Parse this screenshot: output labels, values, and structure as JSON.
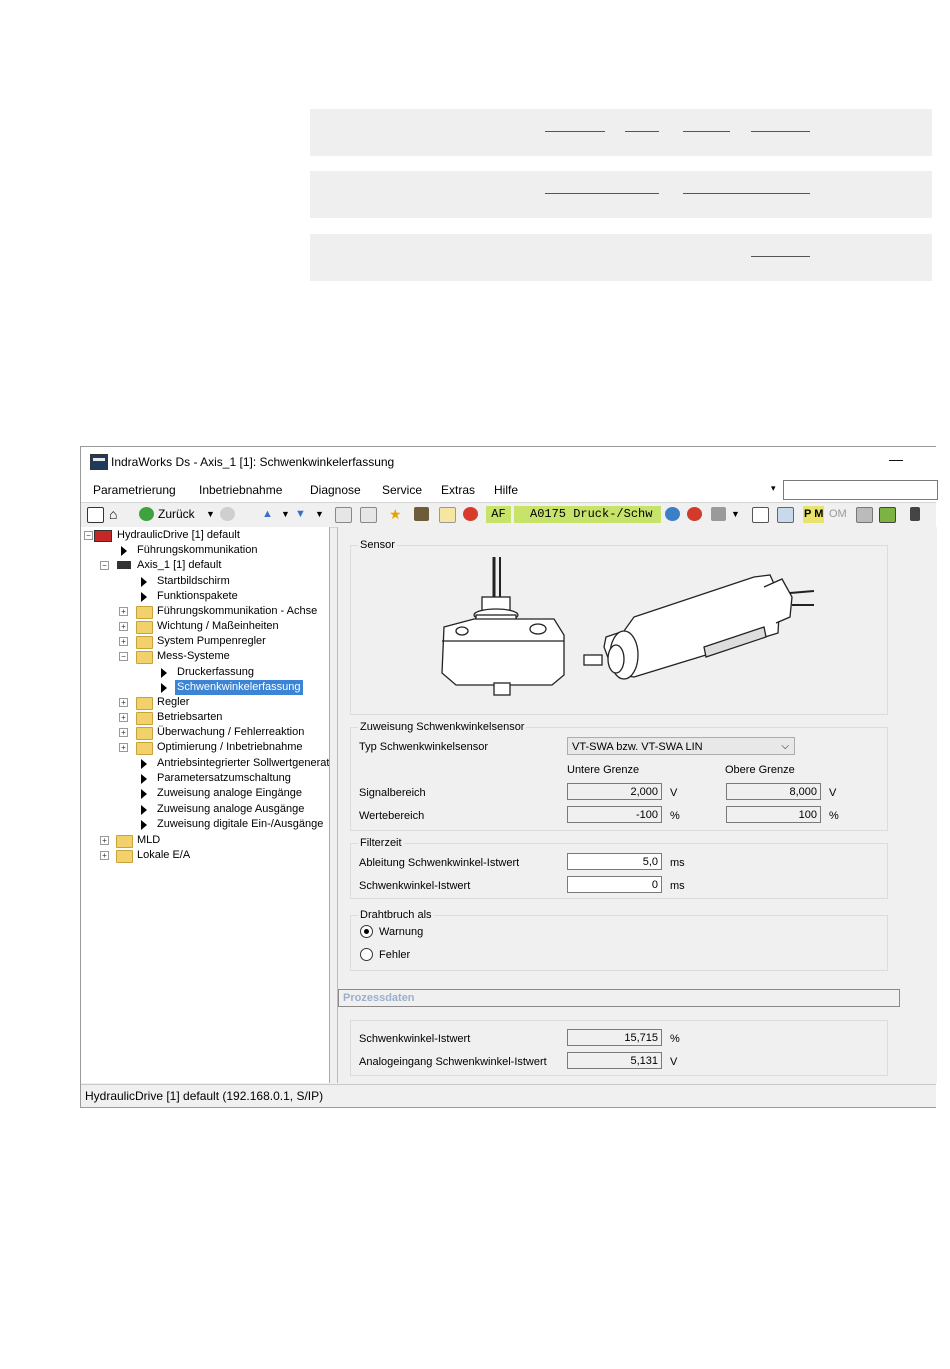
{
  "window": {
    "title": "IndraWorks Ds - Axis_1 [1]: Schwenkwinkelerfassung",
    "minimize_glyph": "—"
  },
  "menu": [
    "Parametrierung",
    "Inbetriebnahme",
    "Diagnose",
    "Service",
    "Extras",
    "Hilfe"
  ],
  "toolbar": {
    "back_label": "Zurück",
    "af_label": "AF",
    "status_code": "A0175 Druck-/Schw",
    "pm_label": "P M",
    "om_label": "OM"
  },
  "tree": {
    "root": "HydraulicDrive [1] default",
    "fuehrung": "Führungskommunikation",
    "axis": "Axis_1 [1] default",
    "items": [
      "Startbildschirm",
      "Funktionspakete",
      "Führungskommunikation - Achse",
      "Wichtung / Maßeinheiten",
      "System Pumpenregler",
      "Mess-Systeme",
      "Druckerfassung",
      "Schwenkwinkelerfassung",
      "Regler",
      "Betriebsarten",
      "Überwachung / Fehlerreaktion",
      "Optimierung / Inbetriebnahme",
      "Antriebsintegrierter Sollwertgenerat",
      "Parametersatzumschaltung",
      "Zuweisung analoge Eingänge",
      "Zuweisung analoge Ausgänge",
      "Zuweisung digitale Ein-/Ausgänge"
    ],
    "mld": "MLD",
    "lokale": "Lokale E/A"
  },
  "content": {
    "sensor_title": "Sensor",
    "assign": {
      "title": "Zuweisung Schwenkwinkelsensor",
      "type_label": "Typ Schwenkwinkelsensor",
      "type_value": "VT-SWA bzw. VT-SWA LIN",
      "lower_header": "Untere Grenze",
      "upper_header": "Obere Grenze",
      "signal_label": "Signalbereich",
      "signal_lower": "2,000",
      "signal_upper": "8,000",
      "signal_unit": "V",
      "werte_label": "Wertebereich",
      "werte_lower": "-100",
      "werte_upper": "100",
      "werte_unit": "%"
    },
    "filter": {
      "title": "Filterzeit",
      "ableitung_label": "Ableitung Schwenkwinkel-Istwert",
      "ableitung_value": "5,0",
      "ist_label": "Schwenkwinkel-Istwert",
      "ist_value": "0",
      "unit": "ms"
    },
    "draht": {
      "title": "Drahtbruch als",
      "opt1": "Warnung",
      "opt2": "Fehler"
    },
    "prozess": {
      "title": "Prozessdaten",
      "ist_label": "Schwenkwinkel-Istwert",
      "ist_value": "15,715",
      "ist_unit": "%",
      "analog_label": "Analogeingang Schwenkwinkel-Istwert",
      "analog_value": "5,131",
      "analog_unit": "V"
    }
  },
  "statusbar": "HydraulicDrive [1] default (192.168.0.1, S/IP)"
}
